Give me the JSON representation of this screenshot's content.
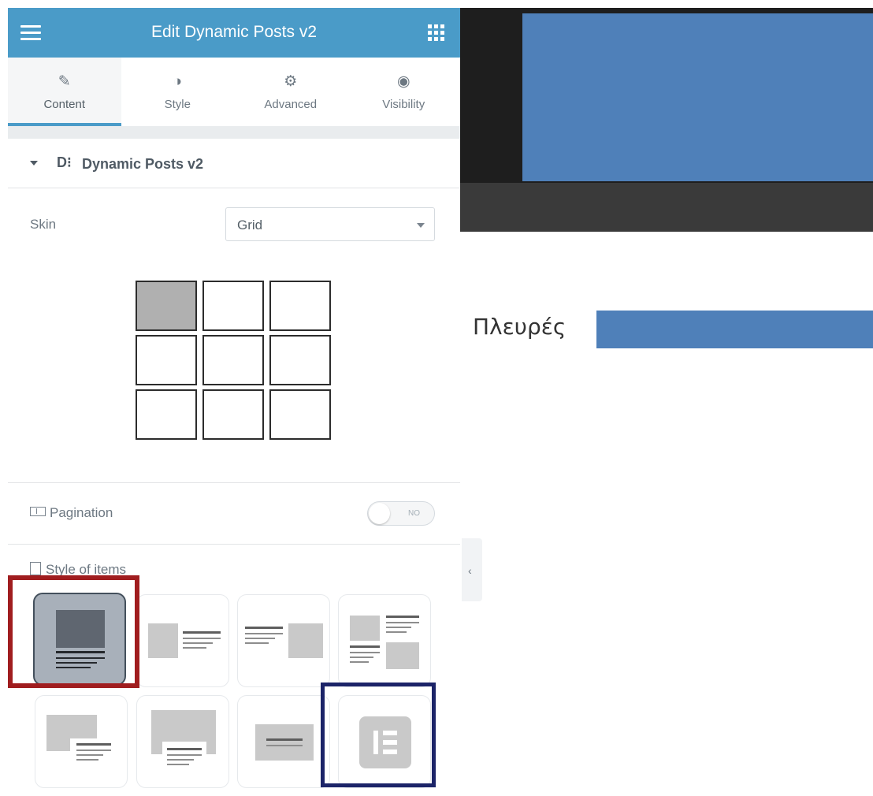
{
  "panel": {
    "title": "Edit Dynamic Posts v2",
    "tabs": [
      {
        "label": "Content",
        "icon": "pencil-icon",
        "glyph": "✎",
        "active": true
      },
      {
        "label": "Style",
        "icon": "half-circle-icon",
        "glyph": "◑",
        "active": false
      },
      {
        "label": "Advanced",
        "icon": "gear-icon",
        "glyph": "⚙",
        "active": false
      },
      {
        "label": "Visibility",
        "icon": "eye-icon",
        "glyph": "◉",
        "active": false
      }
    ],
    "section": {
      "logo": "D⁝",
      "title": "Dynamic Posts v2"
    },
    "skin": {
      "label": "Skin",
      "value": "Grid"
    },
    "pagination": {
      "label": "Pagination",
      "toggle_text": "NO"
    },
    "style_of_items": {
      "label": "Style of items"
    }
  },
  "canvas": {
    "text": "Πλευρές"
  },
  "colors": {
    "header": "#4a9bc8",
    "canvas_blue": "#4f80b9",
    "highlight_red": "#a01d1f",
    "highlight_blue": "#1c2468"
  }
}
